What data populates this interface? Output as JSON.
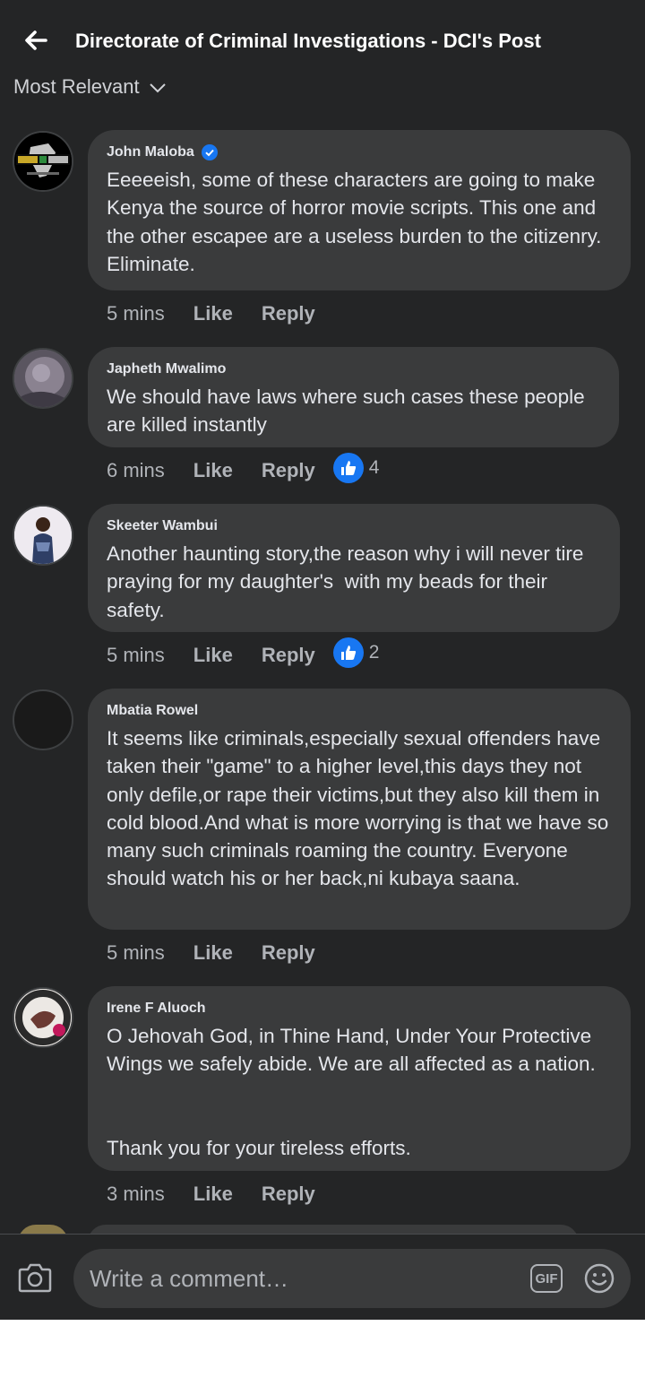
{
  "header": {
    "title": "Directorate of Criminal Investigations - DCI's Post",
    "back_icon": "arrow-left-icon"
  },
  "sort": {
    "label": "Most Relevant",
    "icon": "chevron-down-icon"
  },
  "comments": [
    {
      "name": "John Maloba",
      "verified": true,
      "text": "Eeeeeish, some of these characters are going to make Kenya the source of horror movie scripts. This one and the other escapee are a useless burden to the citizenry. Eliminate.",
      "time": "5 mins",
      "like": "Like",
      "reply": "Reply",
      "reactions": null
    },
    {
      "name": "Japheth Mwalimo",
      "text": "We should have laws where such cases these people are killed instantly",
      "time": "6 mins",
      "like": "Like",
      "reply": "Reply",
      "reactions": "4"
    },
    {
      "name": "Skeeter Wambui",
      "text": "Another haunting story,the reason why i will never tire praying for my daughter's  with my beads for their safety.",
      "time": "5 mins",
      "like": "Like",
      "reply": "Reply",
      "reactions": "2"
    },
    {
      "name": "Mbatia Rowel",
      "text": "It seems like criminals,especially sexual offenders have taken their \"game\" to a higher level,this days they not only defile,or rape their victims,but they also kill them in cold blood.And what is more worrying is that we have so many such criminals roaming the country. Everyone should watch his or her back,ni kubaya saana.",
      "time": "5 mins",
      "like": "Like",
      "reply": "Reply",
      "reactions": null
    },
    {
      "name": "Irene F Aluoch",
      "text": "O Jehovah God, in Thine Hand, Under Your Protective Wings we safely abide. We are all affected as a nation.\n\n\nThank you for your tireless efforts.",
      "time": "3 mins",
      "like": "Like",
      "reply": "Reply",
      "reactions": null
    }
  ],
  "composer": {
    "placeholder": "Write a comment…",
    "gif_label": "GIF",
    "camera_icon": "camera-icon",
    "emoji_icon": "emoji-icon"
  },
  "colors": {
    "background": "#242526",
    "bubble": "#3a3b3c",
    "accent": "#1877f2",
    "muted": "#b0b3b8"
  }
}
